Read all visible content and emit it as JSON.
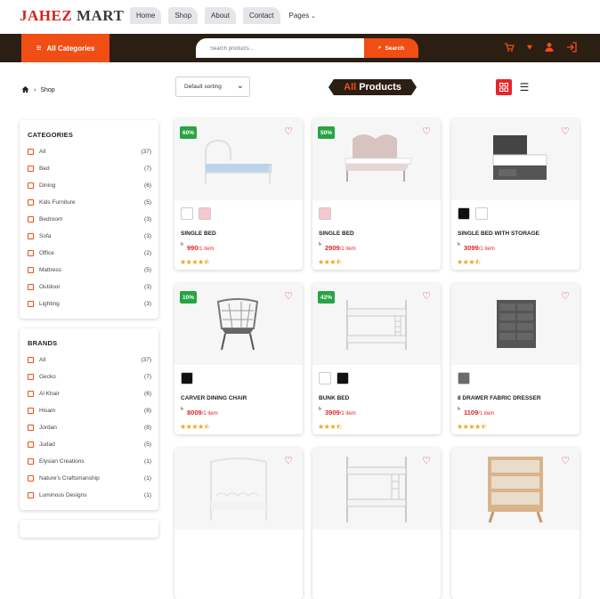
{
  "brand": {
    "part1": "JAHEZ",
    "part2": "MART"
  },
  "nav": {
    "items": [
      "Home",
      "Shop",
      "About",
      "Contact"
    ],
    "pages": "Pages"
  },
  "toolbar": {
    "all_categories": "All Categories",
    "search_placeholder": "Search products...",
    "search_button": "Search"
  },
  "breadcrumb": {
    "current": "Shop"
  },
  "sort": {
    "selected": "Default sorting"
  },
  "banner": {
    "part1": "All",
    "part2": "Products"
  },
  "categories": {
    "title": "CATEGORIES",
    "items": [
      {
        "label": "All",
        "count": "(37)"
      },
      {
        "label": "Bed",
        "count": "(7)"
      },
      {
        "label": "Dining",
        "count": "(6)"
      },
      {
        "label": "Kids Furniture",
        "count": "(5)"
      },
      {
        "label": "Bedroom",
        "count": "(3)"
      },
      {
        "label": "Sofa",
        "count": "(3)"
      },
      {
        "label": "Office",
        "count": "(2)"
      },
      {
        "label": "Mattress",
        "count": "(5)"
      },
      {
        "label": "Outdoor",
        "count": "(3)"
      },
      {
        "label": "Lighting",
        "count": "(3)"
      }
    ]
  },
  "brands": {
    "title": "BRANDS",
    "items": [
      {
        "label": "All",
        "count": "(37)"
      },
      {
        "label": "Gecko",
        "count": "(7)"
      },
      {
        "label": "Al Khair",
        "count": "(6)"
      },
      {
        "label": "Hisam",
        "count": "(8)"
      },
      {
        "label": "Jordan",
        "count": "(8)"
      },
      {
        "label": "Judad",
        "count": "(5)"
      },
      {
        "label": "Elysian Creations",
        "count": "(1)"
      },
      {
        "label": "Nature's Craftsmanship",
        "count": "(1)"
      },
      {
        "label": "Luminous Designs",
        "count": "(1)"
      }
    ]
  },
  "currency": "৳",
  "per_item": "/1 item",
  "products": [
    {
      "name": "SINGLE BED",
      "price": "990",
      "discount": "60%",
      "rating": 4.5,
      "colors": [
        "#ffffff",
        "#f7c6cf"
      ]
    },
    {
      "name": "SINGLE BED",
      "price": "2909",
      "discount": "50%",
      "rating": 3.5,
      "colors": [
        "#f7c6cf"
      ]
    },
    {
      "name": "SINGLE BED WITH STORAGE",
      "price": "3099",
      "discount": "",
      "rating": 3.5,
      "colors": [
        "#111111",
        "#ffffff"
      ]
    },
    {
      "name": "CARVER DINING CHAIR",
      "price": "8009",
      "discount": "10%",
      "rating": 4.5,
      "colors": [
        "#111111"
      ]
    },
    {
      "name": "BUNK BED",
      "price": "3909",
      "discount": "42%",
      "rating": 3.5,
      "colors": [
        "#ffffff",
        "#111111"
      ]
    },
    {
      "name": "8 DRAWER FABRIC DRESSER",
      "price": "1109",
      "discount": "",
      "rating": 4.5,
      "colors": [
        "#6b6b6b"
      ]
    },
    {
      "name": "",
      "price": "",
      "discount": "",
      "rating": 0,
      "colors": []
    },
    {
      "name": "",
      "price": "",
      "discount": "",
      "rating": 0,
      "colors": []
    },
    {
      "name": "",
      "price": "",
      "discount": "",
      "rating": 0,
      "colors": []
    }
  ]
}
